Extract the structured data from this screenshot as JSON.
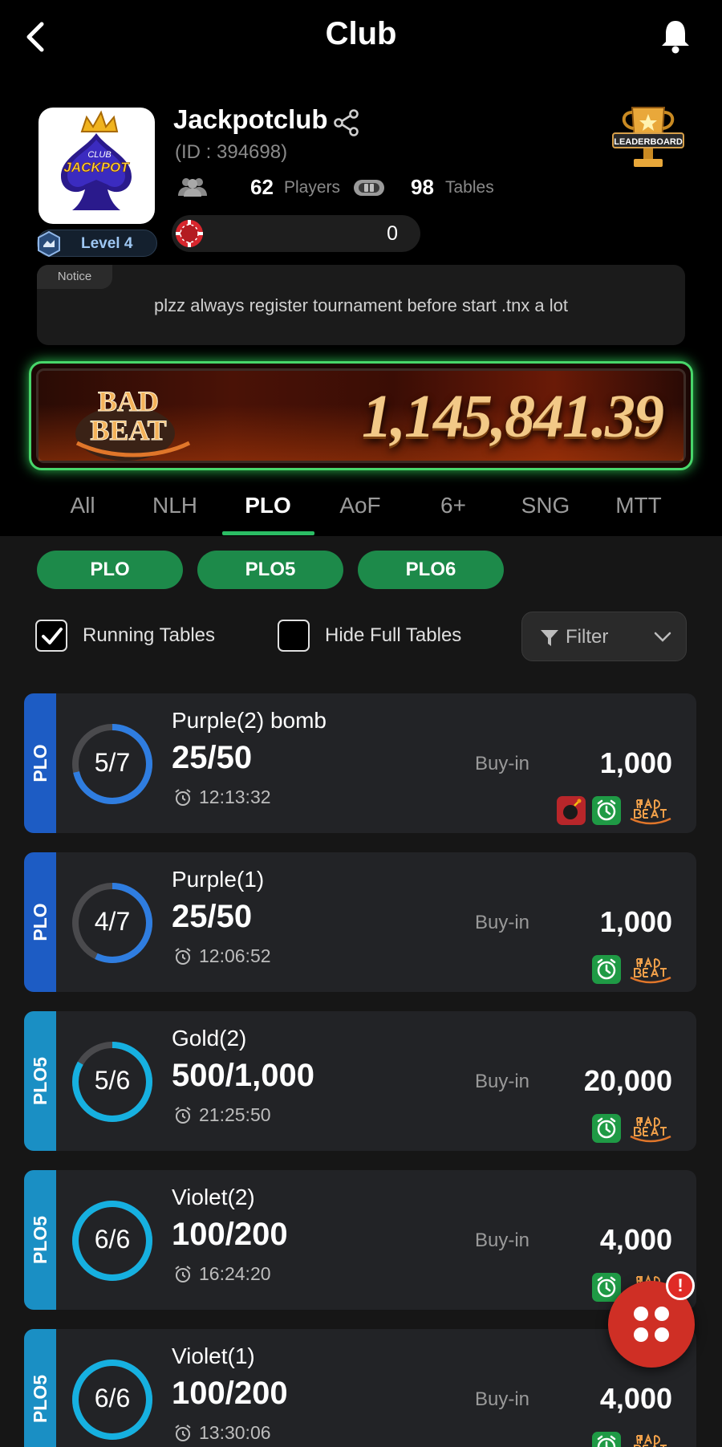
{
  "header": {
    "title": "Club"
  },
  "club": {
    "logo_text_top": "CLUB",
    "logo_text_main": "JACKPOT",
    "name": "Jackpotclub",
    "id_text": "(ID : 394698)",
    "players_count": "62",
    "players_label": "Players",
    "tables_count": "98",
    "tables_label": "Tables",
    "chips": "0",
    "level": "Level 4",
    "leaderboard_label": "LEADERBOARD"
  },
  "notice": {
    "tag": "Notice",
    "message": "plzz always register tournament before start .tnx a lot"
  },
  "bad_beat_banner": {
    "logo_line1": "BAD",
    "logo_line2": "BEAT",
    "jackpot": "1,145,841.39"
  },
  "tabs": [
    {
      "label": "All"
    },
    {
      "label": "NLH"
    },
    {
      "label": "PLO",
      "active": true
    },
    {
      "label": "AoF"
    },
    {
      "label": "6+"
    },
    {
      "label": "SNG"
    },
    {
      "label": "MTT"
    }
  ],
  "subtabs": [
    {
      "label": "PLO"
    },
    {
      "label": "PLO5"
    },
    {
      "label": "PLO6"
    }
  ],
  "filters": {
    "running_tables": {
      "label": "Running Tables",
      "checked": true
    },
    "hide_full_tables": {
      "label": "Hide Full Tables",
      "checked": false
    },
    "filter_label": "Filter"
  },
  "tables": [
    {
      "type": "PLO",
      "seats": "5/7",
      "seated_fraction": 0.714,
      "name": "Purple(2) bomb",
      "blinds": "25/50",
      "time": "12:13:32",
      "buyin_label": "Buy-in",
      "buyin": "1,000",
      "badges": [
        "bomb-icon",
        "timer-icon",
        "bad-beat-icon"
      ],
      "stripe_color": "#1d5cc4",
      "ring_color": "#2f7de0"
    },
    {
      "type": "PLO",
      "seats": "4/7",
      "seated_fraction": 0.571,
      "name": "Purple(1)",
      "blinds": "25/50",
      "time": "12:06:52",
      "buyin_label": "Buy-in",
      "buyin": "1,000",
      "badges": [
        "timer-icon",
        "bad-beat-icon"
      ],
      "stripe_color": "#1d5cc4",
      "ring_color": "#2f7de0"
    },
    {
      "type": "PLO5",
      "seats": "5/6",
      "seated_fraction": 0.833,
      "name": "Gold(2)",
      "blinds": "500/1,000",
      "time": "21:25:50",
      "buyin_label": "Buy-in",
      "buyin": "20,000",
      "badges": [
        "timer-icon",
        "bad-beat-icon"
      ],
      "stripe_color": "#1a8fc4",
      "ring_color": "#16b0e0"
    },
    {
      "type": "PLO5",
      "seats": "6/6",
      "seated_fraction": 1.0,
      "name": "Violet(2)",
      "blinds": "100/200",
      "time": "16:24:20",
      "buyin_label": "Buy-in",
      "buyin": "4,000",
      "badges": [
        "timer-icon",
        "bad-beat-icon"
      ],
      "stripe_color": "#1a8fc4",
      "ring_color": "#16b0e0"
    },
    {
      "type": "PLO5",
      "seats": "6/6",
      "seated_fraction": 1.0,
      "name": "Violet(1)",
      "blinds": "100/200",
      "time": "13:30:06",
      "buyin_label": "Buy-in",
      "buyin": "4,000",
      "badges": [
        "timer-icon",
        "bad-beat-icon"
      ],
      "stripe_color": "#1a8fc4",
      "ring_color": "#16b0e0"
    }
  ],
  "fab": {
    "alert": "!"
  }
}
